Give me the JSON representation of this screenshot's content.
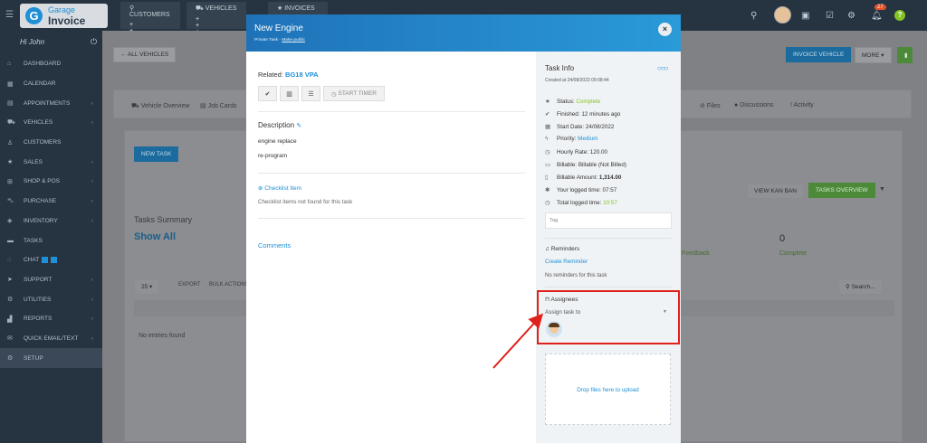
{
  "topbar": {
    "logo_line1": "Garage",
    "logo_line2": "Invoice",
    "tabs": [
      {
        "label": "CUSTOMERS",
        "plus": "+ +"
      },
      {
        "label": "VEHICLES",
        "plus": "+ + +"
      },
      {
        "label": "INVOICES",
        "plus": ""
      }
    ],
    "notification_count": "27"
  },
  "sidebar": {
    "greeting": "Hi John",
    "items": [
      {
        "label": "DASHBOARD",
        "icon": "home-icon"
      },
      {
        "label": "CALENDAR",
        "icon": "calendar-icon"
      },
      {
        "label": "APPOINTMENTS",
        "icon": "clipboard-icon"
      },
      {
        "label": "VEHICLES",
        "icon": "car-icon"
      },
      {
        "label": "CUSTOMERS",
        "icon": "user-icon"
      },
      {
        "label": "SALES",
        "icon": "star-icon"
      },
      {
        "label": "SHOP & POS",
        "icon": "shop-icon"
      },
      {
        "label": "PURCHASE",
        "icon": "cart-icon"
      },
      {
        "label": "INVENTORY",
        "icon": "box-icon"
      },
      {
        "label": "TASKS",
        "icon": "tasks-icon"
      },
      {
        "label": "CHAT",
        "icon": "chat-icon"
      },
      {
        "label": "SUPPORT",
        "icon": "paper-plane-icon"
      },
      {
        "label": "UTILITIES",
        "icon": "gears-icon"
      },
      {
        "label": "REPORTS",
        "icon": "chart-icon"
      },
      {
        "label": "QUICK EMAIL/TEXT",
        "icon": "mail-icon"
      },
      {
        "label": "SETUP",
        "icon": "gear-icon"
      }
    ]
  },
  "background": {
    "all_vehicles": "ALL VEHICLES",
    "invoice_vehicle": "INVOICE VEHICLE",
    "more": "MORE",
    "vehicle_overview": "Vehicle Overview",
    "job_cards": "Job Cards",
    "files": "Files",
    "discussions": "Discussions",
    "activity": "Activity",
    "new_task": "NEW TASK",
    "view_kanban": "VIEW KAN BAN",
    "tasks_overview": "TASKS OVERVIEW",
    "tasks_summary": "Tasks Summary",
    "show_all": "Show All",
    "feedback": "Feedback",
    "complete_count": "0",
    "complete": "Complete",
    "export": "EXPORT",
    "bulk_actions": "BULK ACTIONS",
    "search_placeholder": "Search...",
    "no_entries": "No entries found"
  },
  "modal": {
    "title": "New Engine",
    "subtitle_task": "Private Task",
    "subtitle_link": "Make public",
    "related_label": "Related:",
    "related_value": "BG18 VPA",
    "start_timer": "START TIMER",
    "description_label": "Description",
    "description_lines": [
      "engine replace",
      "re-program"
    ],
    "checklist_label": "Checklist Item",
    "checklist_empty": "Checklist items not found for this task",
    "comments_label": "Comments"
  },
  "task_info": {
    "title": "Task Info",
    "created": "Created at 24/08/2022 09:08:44",
    "rows": [
      {
        "icon": "star-icon",
        "label": "Status:",
        "value": "Complete",
        "style": "green"
      },
      {
        "icon": "check-icon",
        "label": "Finished:",
        "value": "12 minutes ago",
        "style": ""
      },
      {
        "icon": "calendar-icon",
        "label": "Start Date:",
        "value": "24/08/2022",
        "style": ""
      },
      {
        "icon": "bolt-icon",
        "label": "Priority:",
        "value": "Medium",
        "style": "blue"
      },
      {
        "icon": "clock-icon",
        "label": "Hourly Rate:",
        "value": "120.00",
        "style": ""
      },
      {
        "icon": "card-icon",
        "label": "Billable:",
        "value": "Billable (Not Billed)",
        "style": "bold-tail"
      },
      {
        "icon": "file-icon",
        "label": "Billable Amount:",
        "value": "1,314.00",
        "style": "bold"
      },
      {
        "icon": "asterisk-icon",
        "label": "Your logged time:",
        "value": "07:57",
        "style": ""
      },
      {
        "icon": "clock-icon",
        "label": "Total logged time:",
        "value": "10:57",
        "style": "green"
      }
    ],
    "tag_placeholder": "Tag",
    "reminders_label": "Reminders",
    "create_reminder": "Create Reminder",
    "no_reminders": "No reminders for this task",
    "assignees_label": "Assignees",
    "assign_placeholder": "Assign task to",
    "dropzone": "Drop files here to upload"
  },
  "colors": {
    "accent": "#1f8fd6",
    "success": "#84c225",
    "highlight": "#e0201a"
  }
}
